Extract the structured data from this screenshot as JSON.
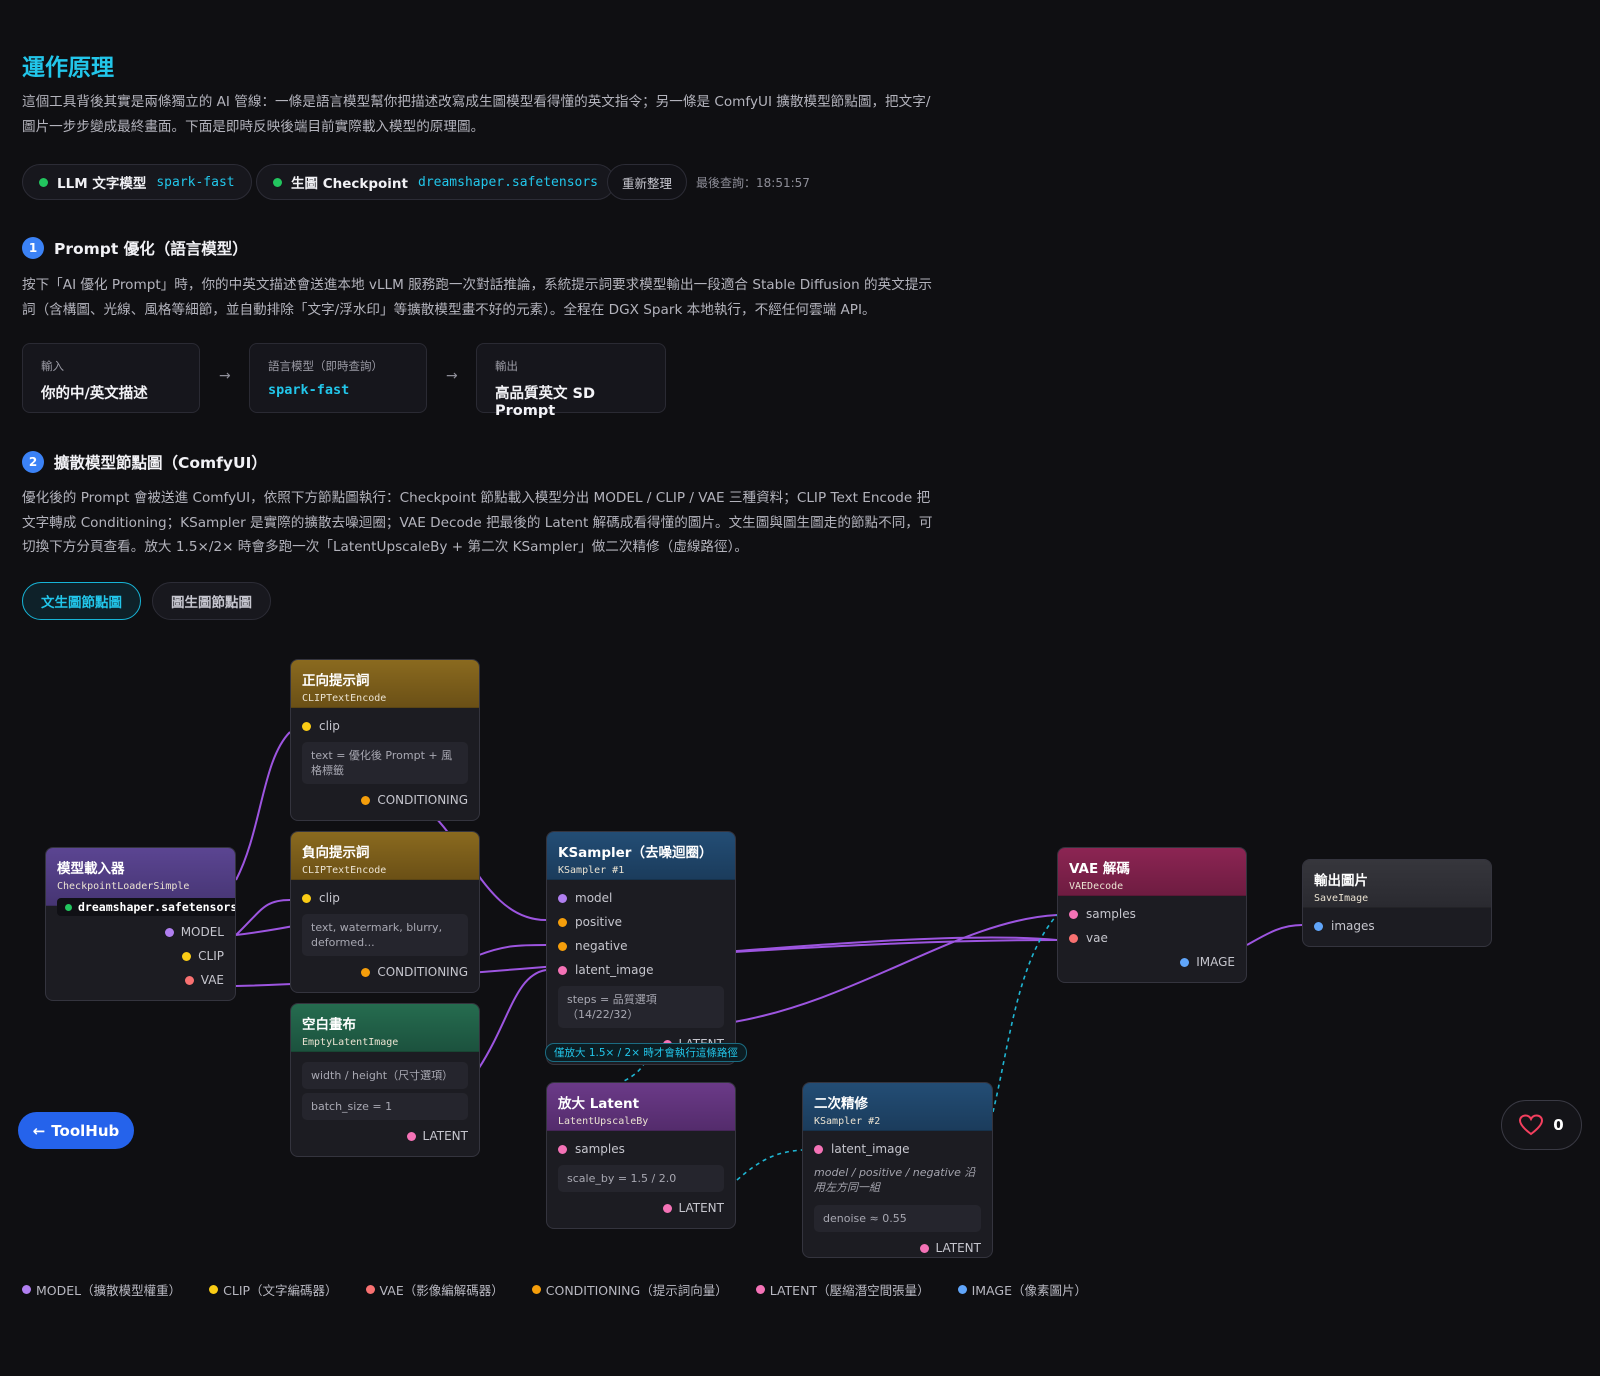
{
  "title": "運作原理",
  "intro": "這個工具背後其實是兩條獨立的 AI 管線：一條是語言模型幫你把描述改寫成生圖模型看得懂的英文指令；另一條是 ComfyUI 擴散模型節點圖，把文字/圖片一步步變成最終畫面。下面是即時反映後端目前實際載入模型的原理圖。",
  "status": {
    "llm_label": "LLM 文字模型",
    "llm_model": "spark-fast",
    "ckpt_label": "生圖 Checkpoint",
    "ckpt_model": "dreamshaper.safetensors",
    "refresh_label": "重新整理",
    "last_query": "最後查詢：18:51:57",
    "dot_color": "#22c55e"
  },
  "section1": {
    "num": "1",
    "title": "Prompt 優化（語言模型）",
    "desc": "按下「AI 優化 Prompt」時，你的中英文描述會送進本地 vLLM 服務跑一次對話推論，系統提示詞要求模型輸出一段適合 Stable Diffusion 的英文提示詞（含構圖、光線、風格等細節，並自動排除「文字/浮水印」等擴散模型畫不好的元素）。全程在 DGX Spark 本地執行，不經任何雲端 API。",
    "pipeline": [
      {
        "key": "輸入",
        "value": "你的中/英文描述"
      },
      {
        "key": "語言模型（即時查詢）",
        "value": "spark-fast"
      },
      {
        "key": "輸出",
        "value": "高品質英文 SD Prompt"
      }
    ],
    "arrow": "→"
  },
  "section2": {
    "num": "2",
    "title": "擴散模型節點圖（ComfyUI）",
    "desc": "優化後的 Prompt 會被送進 ComfyUI，依照下方節點圖執行：Checkpoint 節點載入模型分出 MODEL / CLIP / VAE 三種資料；CLIP Text Encode 把文字轉成 Conditioning；KSampler 是實際的擴散去噪迴圈；VAE Decode 把最後的 Latent 解碼成看得懂的圖片。文生圖與圖生圖走的節點不同，可切換下方分頁查看。放大 1.5×/2× 時會多跑一次「LatentUpscaleBy + 第二次 KSampler」做二次精修（虛線路徑）。"
  },
  "tabs": {
    "txt2img": "文生圖節點圖",
    "img2img": "圖生圖節點圖"
  },
  "colors": {
    "MODEL": "#b07ff0",
    "CLIP": "#facc15",
    "VAE": "#f87171",
    "CONDITIONING": "#f59e0b",
    "LATENT": "#f472b6",
    "IMAGE": "#60a5fa",
    "wire_main": "#9d55e0",
    "wire_dashed": "#1fb5d2",
    "accent": "#22c6ea"
  },
  "nodes": {
    "positive": {
      "title": "正向提示詞",
      "type": "CLIPTextEncode",
      "in_clip": "clip",
      "param": "text = 優化後 Prompt + 風格標籤",
      "out": "CONDITIONING"
    },
    "negative": {
      "title": "負向提示詞",
      "type": "CLIPTextEncode",
      "in_clip": "clip",
      "param": "text, watermark, blurry, deformed...",
      "out": "CONDITIONING"
    },
    "loader": {
      "title": "模型載入器",
      "type": "CheckpointLoaderSimple",
      "model_badge": "dreamshaper.safetensors",
      "out_model": "MODEL",
      "out_clip": "CLIP",
      "out_vae": "VAE"
    },
    "empty": {
      "title": "空白畫布",
      "type": "EmptyLatentImage",
      "param1": "width / height（尺寸選項）",
      "param2": "batch_size = 1",
      "out": "LATENT"
    },
    "ksampler": {
      "title": "KSampler（去噪迴圈）",
      "type": "KSampler #1",
      "in_model": "model",
      "in_positive": "positive",
      "in_negative": "negative",
      "in_latent": "latent_image",
      "param": "steps = 品質選項（14/22/32）",
      "out": "LATENT"
    },
    "vae": {
      "title": "VAE 解碼",
      "type": "VAEDecode",
      "in_samples": "samples",
      "in_vae": "vae",
      "out": "IMAGE"
    },
    "save": {
      "title": "輸出圖片",
      "type": "SaveImage",
      "in_images": "images"
    },
    "upscale": {
      "title": "放大 Latent",
      "type": "LatentUpscaleBy",
      "in_samples": "samples",
      "param": "scale_by = 1.5 / 2.0",
      "out": "LATENT"
    },
    "refine": {
      "title": "二次精修",
      "type": "KSampler #2",
      "in_latent": "latent_image",
      "note": "model / positive / negative 沿用左方同一組",
      "param": "denoise ≈ 0.55",
      "out": "LATENT"
    }
  },
  "upscale_note": "僅放大 1.5× / 2× 時才會執行這條路徑",
  "legend": [
    "MODEL（擴散模型權重）",
    "CLIP（文字編碼器）",
    "VAE（影像編解碼器）",
    "CONDITIONING（提示詞向量）",
    "LATENT（壓縮潛空間張量）",
    "IMAGE（像素圖片）"
  ],
  "toolhub": {
    "arrow": "←",
    "label": "ToolHub"
  },
  "like": {
    "count": "0"
  }
}
